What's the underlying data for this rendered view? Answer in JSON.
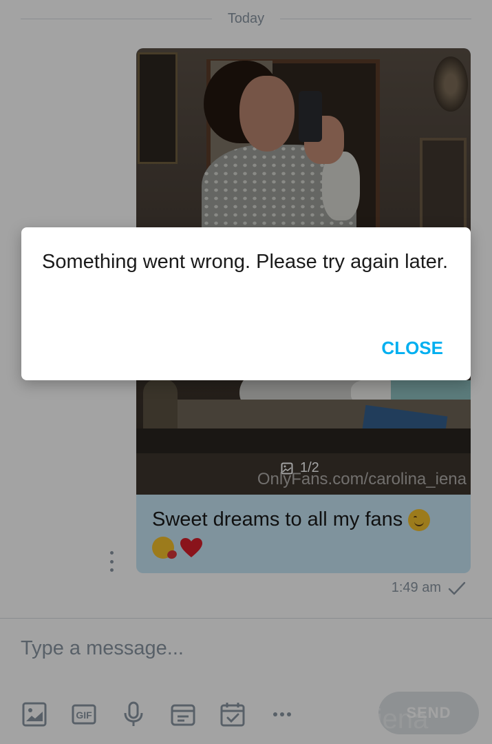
{
  "chat": {
    "date_divider": "Today",
    "message": {
      "media_counter": "1/2",
      "watermark": "OnlyFans.com/carolina_iena",
      "caption": "Sweet dreams to all my fans",
      "emojis": [
        "smiling-face-icon",
        "face-blowing-kiss-icon",
        "red-heart-icon"
      ],
      "time": "1:49 am",
      "status": "sent"
    }
  },
  "composer": {
    "placeholder": "Type a message...",
    "send_label": "SEND",
    "watermark": "na_iena",
    "tools": [
      "image-icon",
      "gif-icon",
      "microphone-icon",
      "vault-icon",
      "schedule-icon",
      "more-icon"
    ],
    "gif_text": "GIF"
  },
  "dialog": {
    "message": "Something went wrong. Please try again later.",
    "close_label": "CLOSE"
  },
  "colors": {
    "accent": "#00aff0",
    "bubble": "#c7e6f6",
    "muted_text": "#8a96a3"
  }
}
